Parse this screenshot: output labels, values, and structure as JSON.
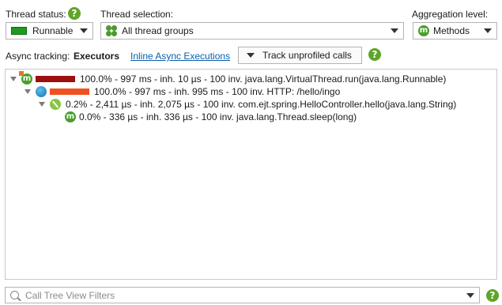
{
  "thread_status": {
    "label": "Thread status:",
    "value": "Runnable",
    "swatch_color": "#1f9a1f"
  },
  "thread_selection": {
    "label": "Thread selection:",
    "value": "All thread groups"
  },
  "aggregation": {
    "label": "Aggregation level:",
    "value": "Methods"
  },
  "async": {
    "label": "Async tracking:",
    "mode": "Executors",
    "link": "Inline Async Executions",
    "button": "Track unprofiled calls"
  },
  "tree": {
    "rows": [
      {
        "text": "100.0% - 997 ms - inh. 10 µs - 100 inv. java.lang.VirtualThread.run(java.lang.Runnable)",
        "bar_fraction": 1.0,
        "bar_color": "#9b1010"
      },
      {
        "text": "100.0% - 997 ms - inh. 995 ms - 100 inv. HTTP: /hello/ingo",
        "bar_fraction": 1.0,
        "bar_color": "#f05020"
      },
      {
        "text": "0.2% - 2,411 µs - inh. 2,075 µs - 100 inv. com.ejt.spring.HelloController.hello(java.lang.String)",
        "bar_fraction": 0.002,
        "bar_color": "#f05020"
      },
      {
        "text": "0.0% - 336 µs - inh. 336 µs - 100 inv. java.lang.Thread.sleep(long)",
        "bar_fraction": 0.0,
        "bar_color": "#f05020"
      }
    ]
  },
  "filter": {
    "placeholder": "Call Tree View Filters"
  },
  "icons": {
    "help": "help-icon",
    "methods": "m-icon"
  }
}
